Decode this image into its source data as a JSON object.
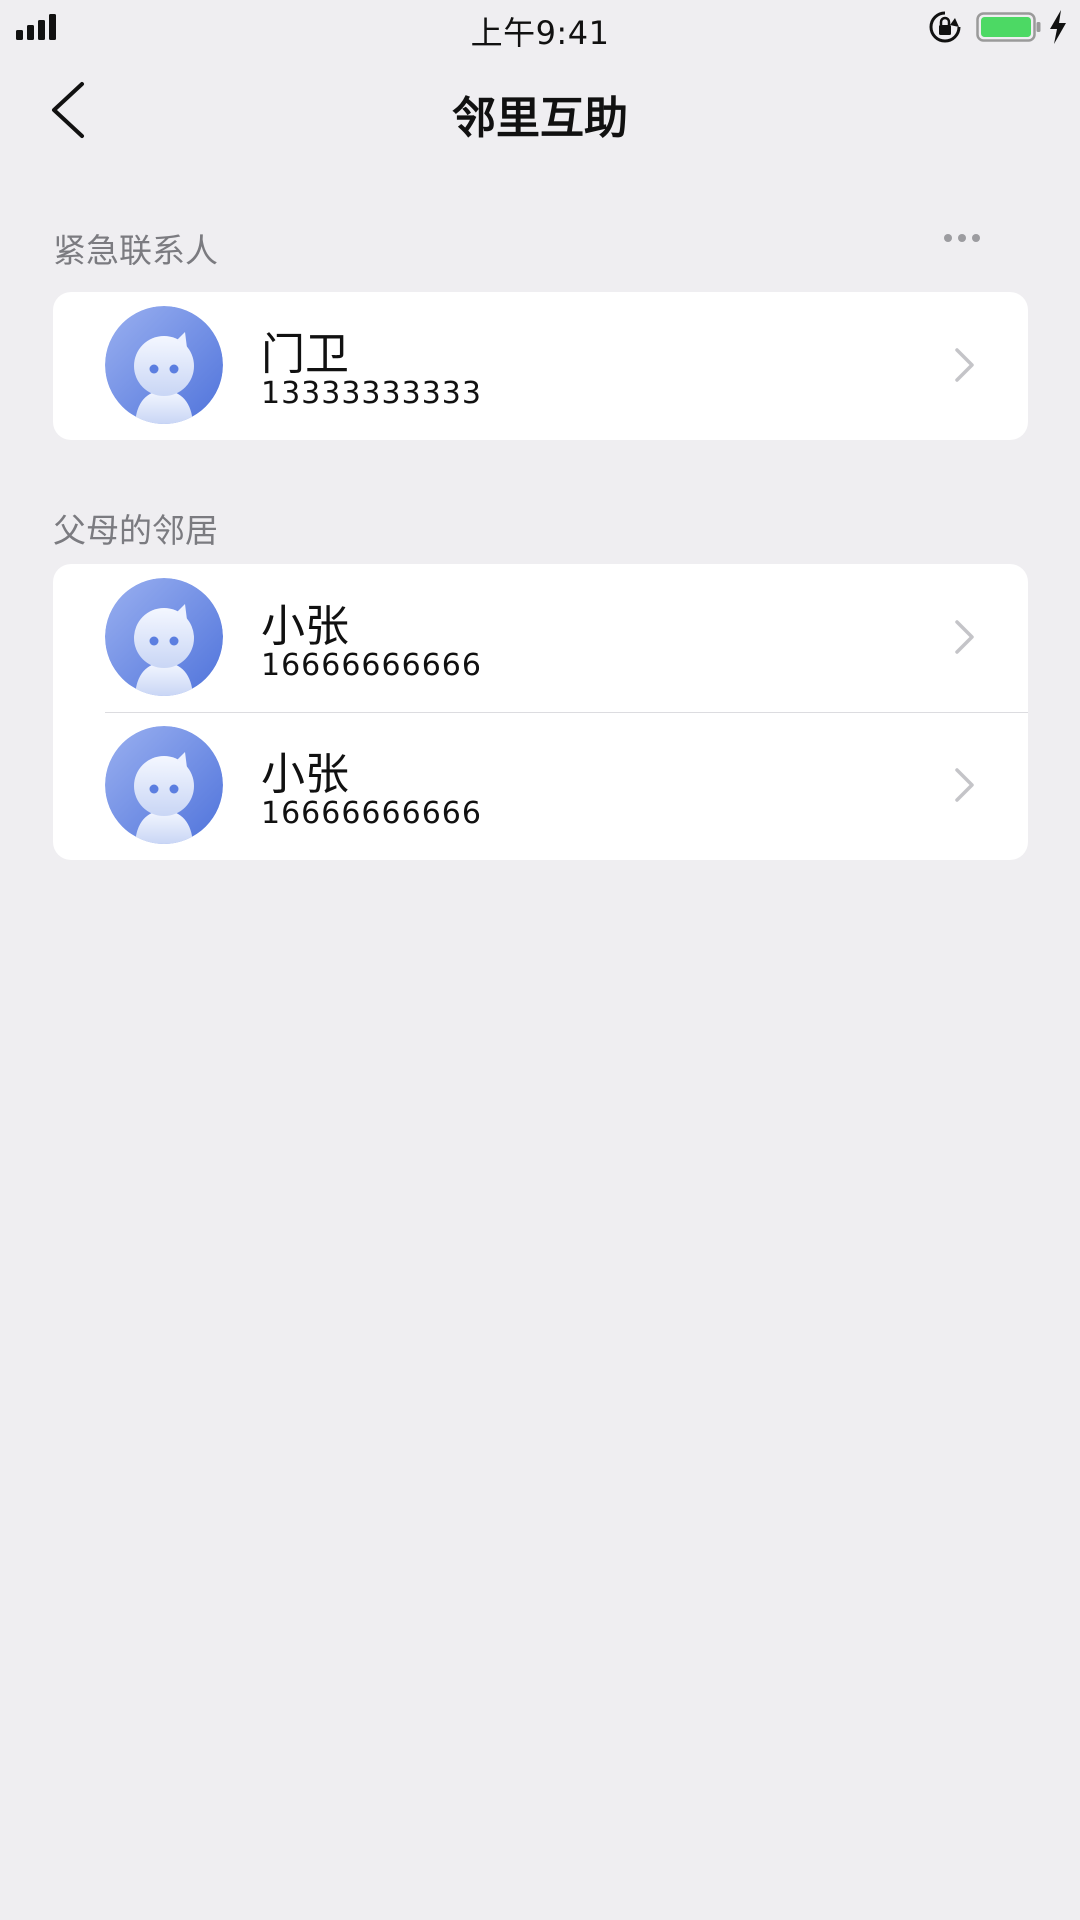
{
  "status_bar": {
    "time": "上午9:41",
    "battery_color": "#4cd964"
  },
  "nav": {
    "title": "邻里互助"
  },
  "sections": [
    {
      "title": "紧急联系人",
      "contacts": [
        {
          "name": "门卫",
          "phone": "13333333333"
        }
      ]
    },
    {
      "title": "父母的邻居",
      "contacts": [
        {
          "name": "小张",
          "phone": "16666666666"
        },
        {
          "name": "小张",
          "phone": "16666666666"
        }
      ]
    }
  ],
  "icons": {
    "back": "chevron-left-icon",
    "more": "more-dots-icon",
    "row": "chevron-right-icon",
    "avatar": "robot-avatar"
  },
  "colors": {
    "background": "#efeef1",
    "card": "#ffffff",
    "secondary_text": "#7b7b80",
    "avatar_blue": "#5b7ee0"
  }
}
